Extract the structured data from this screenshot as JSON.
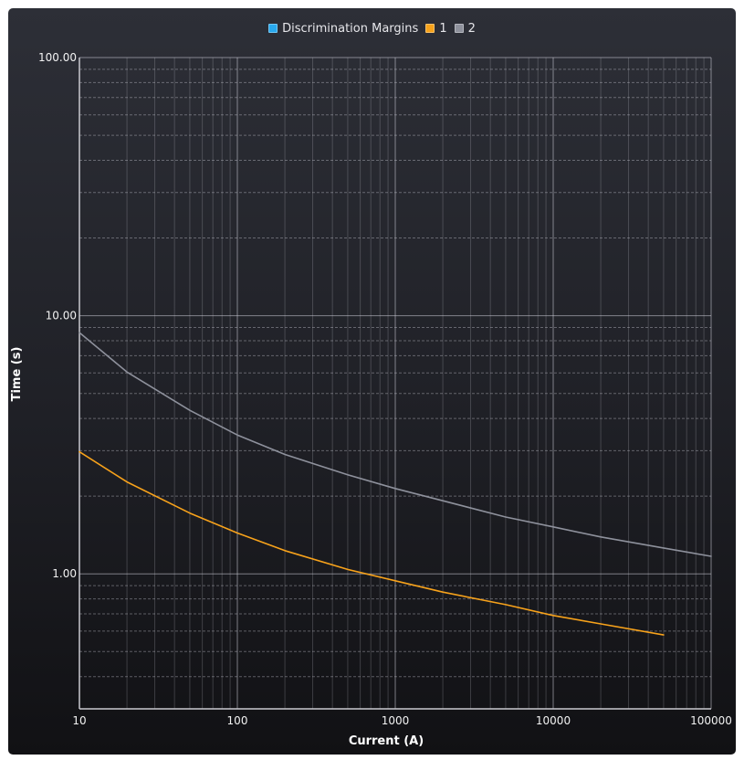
{
  "chart_data": {
    "type": "line",
    "xlabel": "Current (A)",
    "ylabel": "Time (s)",
    "xscale": "log",
    "yscale": "log",
    "xlim": [
      10,
      100000
    ],
    "ylim": [
      0.3,
      100
    ],
    "x_ticks": [
      "10",
      "100",
      "1000",
      "10000",
      "100000"
    ],
    "y_ticks": [
      "100.00",
      "10.00",
      "1.00"
    ],
    "grid": true,
    "legend_position": "top-center",
    "legend": [
      {
        "name": "Discrimination Margins",
        "color": "#29a9ee"
      },
      {
        "name": "1",
        "color": "#f7a21b"
      },
      {
        "name": "2",
        "color": "#8e919c"
      }
    ],
    "series": [
      {
        "name": "1",
        "color": "#f7a21b",
        "x": [
          10,
          20,
          50,
          100,
          200,
          500,
          1000,
          2000,
          5000,
          10000,
          20000,
          50000
        ],
        "y": [
          2.97,
          2.27,
          1.72,
          1.44,
          1.23,
          1.04,
          0.94,
          0.85,
          0.76,
          0.69,
          0.64,
          0.58
        ]
      },
      {
        "name": "2",
        "color": "#8e919c",
        "x": [
          10,
          20,
          50,
          100,
          200,
          500,
          1000,
          2000,
          5000,
          10000,
          20000,
          50000,
          100000
        ],
        "y": [
          8.6,
          6.05,
          4.3,
          3.45,
          2.9,
          2.42,
          2.14,
          1.92,
          1.66,
          1.52,
          1.39,
          1.26,
          1.17
        ]
      }
    ]
  }
}
